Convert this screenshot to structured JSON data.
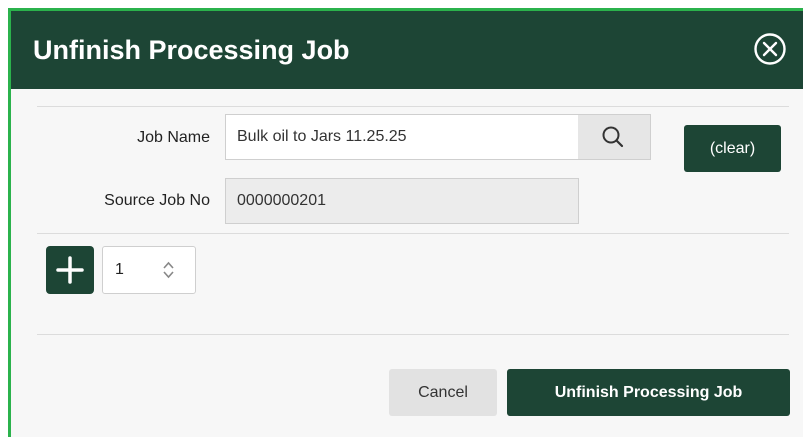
{
  "dialog": {
    "title": "Unfinish Processing Job",
    "close_icon": "circle-x-icon"
  },
  "form": {
    "job_name_label": "Job Name",
    "job_name_value": "Bulk oil to Jars 11.25.25",
    "search_icon": "search-icon",
    "clear_label": "(clear)",
    "source_job_label": "Source Job No",
    "source_job_value": "0000000201"
  },
  "quantity": {
    "add_icon": "plus-icon",
    "value": "1",
    "arrows_icon": "chevron-up-down-icon"
  },
  "footer": {
    "cancel_label": "Cancel",
    "submit_label": "Unfinish Processing Job"
  },
  "colors": {
    "header": "#1d4535",
    "accent_border": "#2bb24c",
    "button_primary": "#1d4535",
    "button_secondary": "#e2e2e2",
    "panel_bg": "#f7f7f7"
  }
}
